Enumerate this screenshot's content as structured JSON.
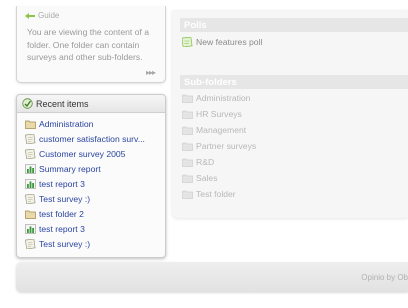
{
  "guide": {
    "title": "Guide",
    "text": "You are viewing the content of a folder. One folder can contain surveys and other sub-folders.",
    "more": "▸▸▸"
  },
  "recent": {
    "title": "Recent items",
    "items": [
      {
        "label": "Administration",
        "icon": "folder-icon"
      },
      {
        "label": "customer satisfaction surv...",
        "icon": "survey-icon"
      },
      {
        "label": "Customer survey 2005",
        "icon": "survey-icon"
      },
      {
        "label": "Summary report",
        "icon": "report-icon"
      },
      {
        "label": "test report 3",
        "icon": "report-icon"
      },
      {
        "label": "Test survey :)",
        "icon": "survey-icon"
      },
      {
        "label": "test folder 2",
        "icon": "folder-icon"
      },
      {
        "label": "test report 3",
        "icon": "report-icon"
      },
      {
        "label": "Test survey :)",
        "icon": "survey-icon"
      }
    ]
  },
  "polls": {
    "title": "Polls",
    "items": [
      {
        "label": "New features poll",
        "icon": "poll-icon"
      }
    ]
  },
  "subfolders": {
    "title": "Sub-folders",
    "items": [
      {
        "label": "Administration",
        "icon": "folder-icon"
      },
      {
        "label": "HR Surveys",
        "icon": "folder-icon"
      },
      {
        "label": "Management",
        "icon": "folder-icon"
      },
      {
        "label": "Partner surveys",
        "icon": "folder-icon"
      },
      {
        "label": "R&D",
        "icon": "folder-icon"
      },
      {
        "label": "Sales",
        "icon": "folder-icon"
      },
      {
        "label": "Test folder",
        "icon": "folder-icon"
      }
    ]
  },
  "footer": {
    "text": "Opinio by Ob"
  },
  "colors": {
    "link": "#2a44a0",
    "section_header": "#e6e6e6",
    "poll_icon": "#7fbf3f",
    "report_bars": "#3a9a3a"
  }
}
